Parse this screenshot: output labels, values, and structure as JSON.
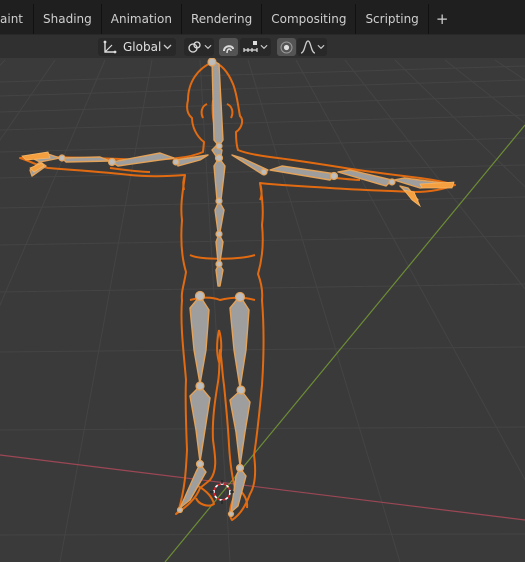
{
  "workspace_tabs": [
    "aint",
    "Shading",
    "Animation",
    "Rendering",
    "Compositing",
    "Scripting",
    "+"
  ],
  "header": {
    "orientation_icon": "transform-orientation-icon",
    "orientation_value": "Global",
    "pivot_icon": "pivot-point-icon",
    "snap_icon": "snap-icon",
    "snap_increment_icon": "snap-increment-icon",
    "proportional_icon": "proportional-editing-icon",
    "falloff_icon": "falloff-curve-icon"
  },
  "colors": {
    "viewport_bg": "#3a3a3a",
    "grid_line": "#444444",
    "x_axis": "#9c4755",
    "y_axis": "#6d8c35",
    "mesh_outline": "#e26b11",
    "bone_fill": "#9e9e9e",
    "bone_outline": "#e2a25a",
    "selected_highlight": "#f5a040"
  }
}
